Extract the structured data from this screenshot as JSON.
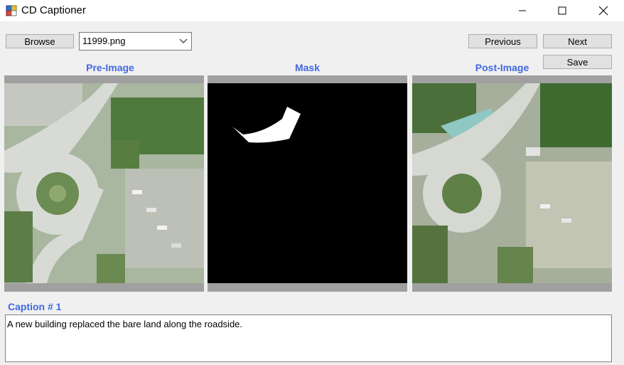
{
  "window": {
    "title": "CD Captioner"
  },
  "toolbar": {
    "browse_label": "Browse",
    "file_selected": "11999.png",
    "previous_label": "Previous",
    "next_label": "Next",
    "save_label": "Save"
  },
  "panels": {
    "pre_label": "Pre-Image",
    "mask_label": "Mask",
    "post_label": "Post-Image"
  },
  "caption": {
    "label": "Caption # 1",
    "text": "A new building replaced the bare land along the roadside."
  },
  "colors": {
    "accent": "#4169e1",
    "panel_frame": "#a0a0a0"
  },
  "icons": [
    "app-icon",
    "minimize-icon",
    "maximize-icon",
    "close-icon",
    "chevron-down-icon"
  ]
}
